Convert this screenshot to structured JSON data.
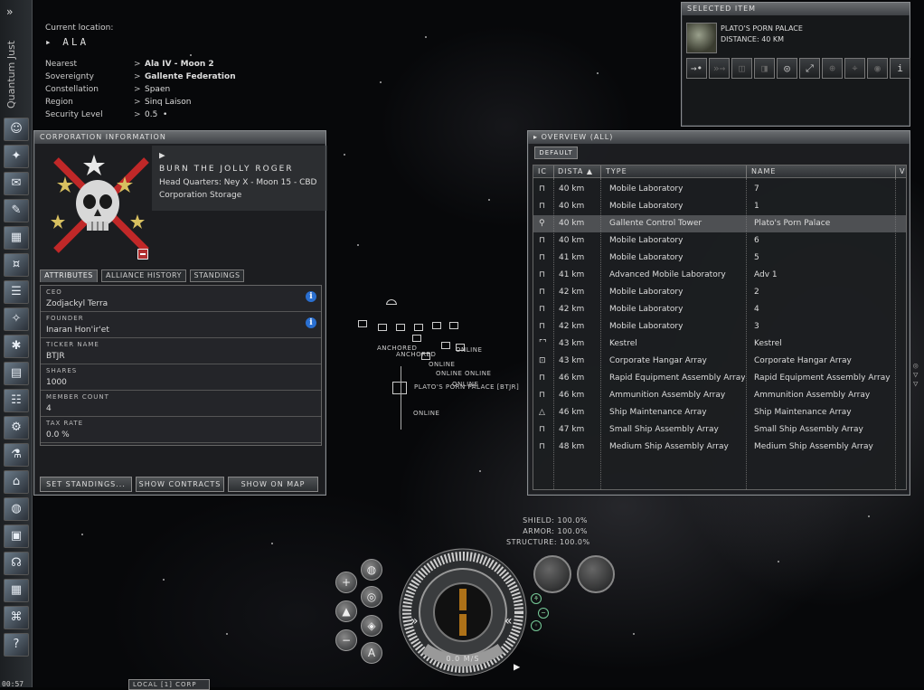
{
  "neocom": {
    "mode_label": "Quantum Just",
    "expand_glyph": "»",
    "clock": "00:57",
    "buttons": [
      {
        "icon": "character-sheet-icon"
      },
      {
        "icon": "people-places-icon"
      },
      {
        "icon": "mail-icon"
      },
      {
        "icon": "notepad-icon"
      },
      {
        "icon": "assets-icon"
      },
      {
        "icon": "wallet-icon"
      },
      {
        "icon": "journal-icon"
      },
      {
        "icon": "map-icon"
      },
      {
        "icon": "starmap-icon"
      },
      {
        "icon": "market-icon"
      },
      {
        "icon": "skills-icon"
      },
      {
        "icon": "fitting-icon"
      },
      {
        "icon": "science-icon"
      },
      {
        "icon": "factory-icon"
      },
      {
        "icon": "browser-icon"
      },
      {
        "icon": "corporation-icon"
      },
      {
        "icon": "headset-icon"
      },
      {
        "icon": "calculator-icon"
      },
      {
        "icon": "ship-hangar-icon"
      },
      {
        "icon": "help-icon"
      }
    ]
  },
  "location": {
    "current_label": "Current location:",
    "system": "ALA",
    "rows": [
      {
        "key": "Nearest",
        "value": "Ala IV - Moon 2"
      },
      {
        "key": "Sovereignty",
        "value": "Gallente Federation"
      },
      {
        "key": "Constellation",
        "value": "Spaen"
      },
      {
        "key": "Region",
        "value": "Sinq Laison"
      },
      {
        "key": "Security Level",
        "value": "0.5"
      }
    ],
    "arrow": ">"
  },
  "selected_item": {
    "title": "SELECTED ITEM",
    "name": "PLATO'S PORN PALACE",
    "distance": "DISTANCE: 40 KM",
    "actions": [
      {
        "icon": "approach-icon",
        "glyph": "→•",
        "enabled": true
      },
      {
        "icon": "warp-to-icon",
        "glyph": "»→",
        "enabled": false
      },
      {
        "icon": "jump-icon",
        "glyph": "◫",
        "enabled": false
      },
      {
        "icon": "dock-icon",
        "glyph": "◨",
        "enabled": false
      },
      {
        "icon": "orbit-icon",
        "glyph": "◎",
        "enabled": true
      },
      {
        "icon": "keep-at-range-icon",
        "glyph": "⤢",
        "enabled": true
      },
      {
        "icon": "lock-target-icon",
        "glyph": "⊕",
        "enabled": false
      },
      {
        "icon": "target-icon",
        "glyph": "⌖",
        "enabled": false
      },
      {
        "icon": "look-at-icon",
        "glyph": "◉",
        "enabled": false
      },
      {
        "icon": "info-icon",
        "glyph": "i",
        "enabled": true
      }
    ]
  },
  "corp": {
    "title": "CORPORATION INFORMATION",
    "name": "BURN THE JOLLY ROGER",
    "hq": "Head Quarters: Ney X - Moon 15 - CBD",
    "storage": "Corporation Storage",
    "tabs": [
      "ATTRIBUTES",
      "ALLIANCE HISTORY",
      "STANDINGS"
    ],
    "attributes": [
      {
        "key": "CEO",
        "value": "Zodjackyl Terra",
        "info": true
      },
      {
        "key": "FOUNDER",
        "value": "Inaran Hon'ir'et",
        "info": true
      },
      {
        "key": "TICKER NAME",
        "value": "BTJR",
        "info": false
      },
      {
        "key": "SHARES",
        "value": "1000",
        "info": false
      },
      {
        "key": "MEMBER COUNT",
        "value": "4",
        "info": false
      },
      {
        "key": "TAX RATE",
        "value": "0.0 %",
        "info": false
      }
    ],
    "buttons": [
      "SET STANDINGS...",
      "SHOW CONTRACTS",
      "SHOW ON MAP"
    ]
  },
  "overview": {
    "title": "OVERVIEW (ALL)",
    "tab": "DEFAULT",
    "columns": [
      "IC",
      "DISTA",
      "TYPE",
      "NAME",
      "V"
    ],
    "rows": [
      {
        "icon": "structure",
        "distance": "40 km",
        "type": "Mobile Laboratory",
        "name": "7",
        "selected": false
      },
      {
        "icon": "structure",
        "distance": "40 km",
        "type": "Mobile Laboratory",
        "name": "1",
        "selected": false
      },
      {
        "icon": "tower",
        "distance": "40 km",
        "type": "Gallente Control Tower",
        "name": "Plato's Porn Palace",
        "selected": true
      },
      {
        "icon": "structure",
        "distance": "40 km",
        "type": "Mobile Laboratory",
        "name": "6",
        "selected": false
      },
      {
        "icon": "structure",
        "distance": "41 km",
        "type": "Mobile Laboratory",
        "name": "5",
        "selected": false
      },
      {
        "icon": "structure",
        "distance": "41 km",
        "type": "Advanced Mobile Laboratory",
        "name": "Adv 1",
        "selected": false
      },
      {
        "icon": "structure",
        "distance": "42 km",
        "type": "Mobile Laboratory",
        "name": "2",
        "selected": false
      },
      {
        "icon": "structure",
        "distance": "42 km",
        "type": "Mobile Laboratory",
        "name": "4",
        "selected": false
      },
      {
        "icon": "structure",
        "distance": "42 km",
        "type": "Mobile Laboratory",
        "name": "3",
        "selected": false
      },
      {
        "icon": "ship",
        "distance": "43 km",
        "type": "Kestrel",
        "name": "Kestrel",
        "selected": false
      },
      {
        "icon": "hangar",
        "distance": "43 km",
        "type": "Corporate Hangar Array",
        "name": "Corporate Hangar Array",
        "selected": false
      },
      {
        "icon": "structure",
        "distance": "46 km",
        "type": "Rapid Equipment Assembly Array",
        "name": "Rapid Equipment Assembly Array",
        "selected": false
      },
      {
        "icon": "structure",
        "distance": "46 km",
        "type": "Ammunition Assembly Array",
        "name": "Ammunition Assembly Array",
        "selected": false
      },
      {
        "icon": "maintenance",
        "distance": "46 km",
        "type": "Ship Maintenance Array",
        "name": "Ship Maintenance Array",
        "selected": false
      },
      {
        "icon": "structure",
        "distance": "47 km",
        "type": "Small Ship Assembly Array",
        "name": "Small Ship Assembly Array",
        "selected": false
      },
      {
        "icon": "structure",
        "distance": "48 km",
        "type": "Medium Ship Assembly Array",
        "name": "Medium Ship Assembly Array",
        "selected": false
      }
    ]
  },
  "space": {
    "labels": [
      "ANCHORED",
      "ANCHORED",
      "ONLINE",
      "ONLINE",
      "ONLINE",
      "ONLINE",
      "ONLINE",
      "PLATO'S PORN PALACE [BTJR]",
      "ONLINE"
    ]
  },
  "hud": {
    "shield": "SHIELD: 100.0%",
    "armor": "ARMOR: 100.0%",
    "structure": "STRUCTURE: 100.0%",
    "speed": "0.0 M/S",
    "controls": [
      {
        "icon": "zoom-in-icon",
        "glyph": "+"
      },
      {
        "icon": "camera-icon",
        "glyph": "◍"
      },
      {
        "icon": "scanner-icon",
        "glyph": "◎"
      },
      {
        "icon": "ship-icon",
        "glyph": "▲"
      },
      {
        "icon": "tactical-icon",
        "glyph": "◈"
      },
      {
        "icon": "zoom-out-icon",
        "glyph": "−"
      },
      {
        "icon": "autopilot-icon",
        "glyph": "A"
      }
    ]
  },
  "chat": {
    "local_tab": "LOCAL [1] CORP"
  }
}
